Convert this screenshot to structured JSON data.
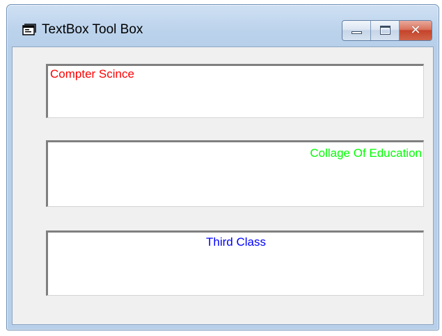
{
  "window": {
    "title": "TextBox Tool Box",
    "icon": "form-icon",
    "caption_buttons": {
      "minimize": "minimize-icon",
      "maximize": "maximize-icon",
      "close": "close-icon",
      "close_glyph": "✕"
    }
  },
  "textboxes": [
    {
      "value": "Compter Scince",
      "color": "#ff0000",
      "align": "left"
    },
    {
      "value": "Collage Of Education",
      "color": "#00ff00",
      "align": "right"
    },
    {
      "value": "Third Class",
      "color": "#0000ff",
      "align": "center"
    }
  ]
}
